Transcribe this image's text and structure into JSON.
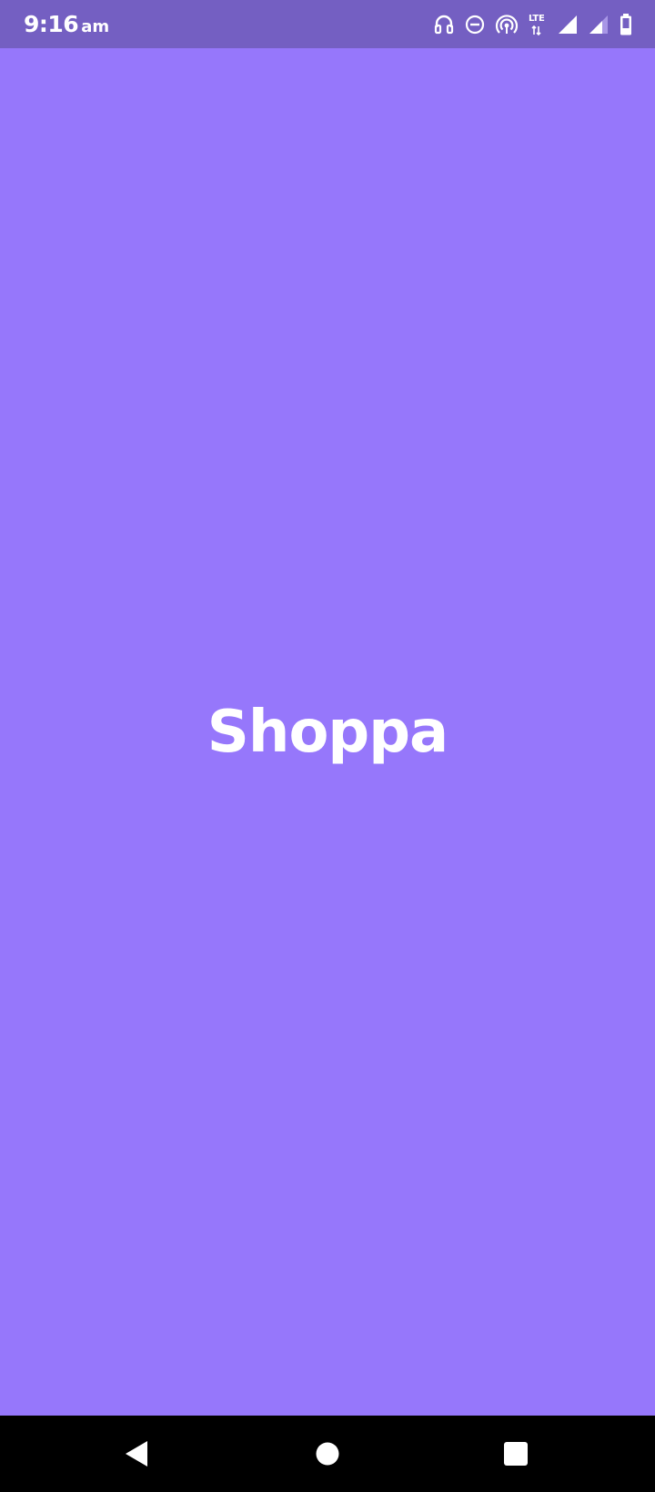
{
  "status_bar": {
    "time": "9:16",
    "ampm": "am",
    "network_label": "LTE",
    "icons": [
      "headphones-icon",
      "do-not-disturb-icon",
      "hotspot-icon",
      "lte-icon",
      "signal-icon",
      "signal-secondary-icon",
      "battery-icon"
    ]
  },
  "splash": {
    "app_name": "Shoppa"
  },
  "nav_bar": {
    "buttons": [
      "back-icon",
      "home-icon",
      "recents-icon"
    ]
  },
  "colors": {
    "background": "#9677fb",
    "status_bar": "#745fc2",
    "nav_bar": "#000000",
    "text": "#ffffff"
  }
}
